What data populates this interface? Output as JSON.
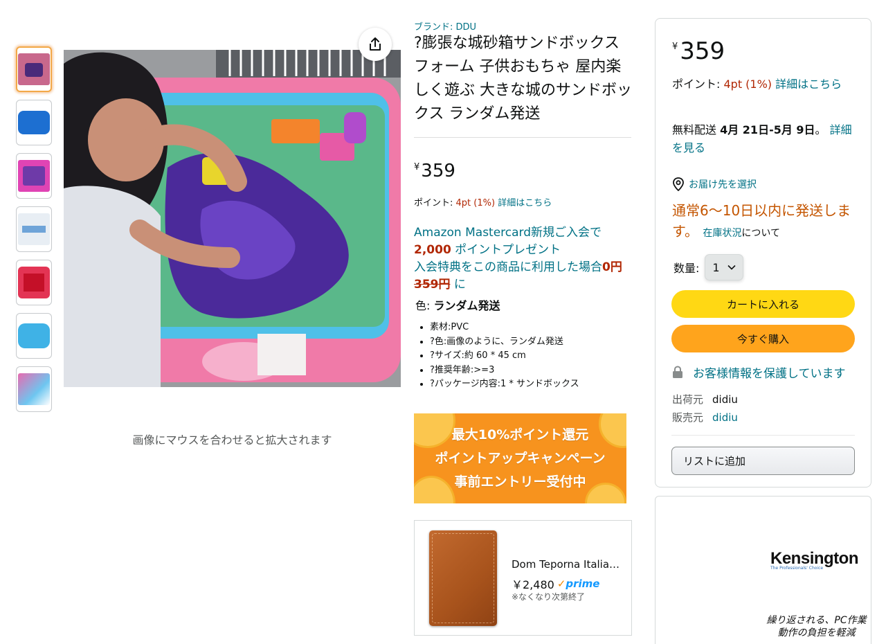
{
  "thumbnails": [
    {
      "name": "thumb-1",
      "active": true
    },
    {
      "name": "thumb-2",
      "active": false
    },
    {
      "name": "thumb-3",
      "active": false
    },
    {
      "name": "thumb-4",
      "active": false
    },
    {
      "name": "thumb-5",
      "active": false
    },
    {
      "name": "thumb-6",
      "active": false
    },
    {
      "name": "thumb-7",
      "active": false
    }
  ],
  "image": {
    "hover_hint": "画像にマウスを合わせると拡大されます"
  },
  "product": {
    "brand": "ブランド: DDU",
    "title": "?膨張な城砂箱サンドボックス フォーム 子供おもちゃ 屋内楽しく遊ぶ 大きな城のサンドボックス ランダム発送",
    "price_symbol": "¥",
    "price": "359",
    "points_label": "ポイント: ",
    "points_value": "4pt  (1%)",
    "points_link": "詳細はこちら",
    "promo_line1": "Amazon Mastercard新規ご入会で",
    "promo_amount": "2,000",
    "promo_line2": " ポイントプレゼント",
    "promo_line3": "入会特典をこの商品に利用した場合",
    "promo_zero": "0円",
    "promo_strike": "359円",
    "promo_ni": " に",
    "color_label": "色: ",
    "color_value": "ランダム発送",
    "bullets": [
      "素材:PVC",
      "?色:画像のように、ランダム発送",
      "?サイズ:約 60 * 45 cm",
      "?推奨年齢:>=3",
      "?パッケージ内容:1 * サンドボックス"
    ]
  },
  "campaign": {
    "line1": "最大10%ポイント還元",
    "line2": "ポイントアップキャンペーン",
    "line3": "事前エントリー受付中"
  },
  "sponsored": {
    "name": "Dom Teporna Italia 財布",
    "price": "￥2,480",
    "prime": "prime",
    "note": "※なくなり次第終了"
  },
  "buybox": {
    "price_symbol": "¥",
    "price": "359",
    "points_label": "ポイント: ",
    "points_value": "4pt  (1%)",
    "points_link": "詳細はこちら",
    "delivery_prefix": "無料配送 ",
    "delivery_dates": "4月 21日-5月 9日",
    "delivery_suffix": "。 ",
    "delivery_link": "詳細を見る",
    "location": "お届け先を選択",
    "ship_text": "通常6〜10日以内に発送します。",
    "stock_link": "在庫状況",
    "stock_suffix": "について",
    "qty_label": "数量:",
    "qty_value": "1",
    "cart_button": "カートに入れる",
    "buy_button": "今すぐ購入",
    "secure_text": "お客様情報を保護しています",
    "shipper_label": "出荷元",
    "shipper_value": "didiu",
    "seller_label": "販売元",
    "seller_value": "didiu",
    "list_button": "リストに追加"
  },
  "ad": {
    "logo": "Kensington",
    "logo_sub": "The Professionals' Choice",
    "text": "繰り返される、PC作業動作の負担を軽減"
  },
  "colors": {
    "link": "#007185",
    "price_red": "#b12704",
    "ship_orange": "#c45500",
    "cart_yellow": "#ffd814",
    "buy_orange": "#ffa41c"
  }
}
